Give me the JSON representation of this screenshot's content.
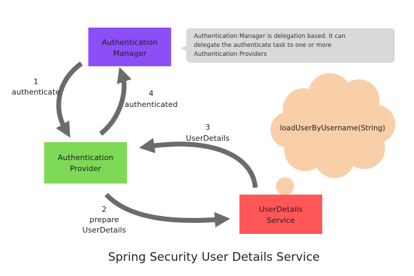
{
  "nodes": {
    "auth_manager": {
      "line1": "Authentication",
      "line2": "Manager",
      "color": "#8c4ef7"
    },
    "auth_provider": {
      "line1": "Authentication",
      "line2": "Provider",
      "color": "#7ed957"
    },
    "user_details_service": {
      "line1": "UserDetails",
      "line2": "Service",
      "color": "#ff5757"
    }
  },
  "note": {
    "line1": "Authentication Manager is delegation based. It can",
    "line2": "delegate the authenticate task to one or more",
    "line3": "Authentication Providers",
    "color": "#d9d9d9"
  },
  "cloud": {
    "text": "loadUserByUsername(String)",
    "color": "#f8cfa9"
  },
  "steps": {
    "step1": {
      "num": "1",
      "label": "authenticate"
    },
    "step2": {
      "num": "2",
      "line1": "prepare",
      "line2": "UserDetails"
    },
    "step3": {
      "num": "3",
      "label": "UserDetails"
    },
    "step4": {
      "num": "4",
      "label": "authenticated"
    }
  },
  "title": "Spring Security User Details Service",
  "arrow_color": "#6b6b6b"
}
